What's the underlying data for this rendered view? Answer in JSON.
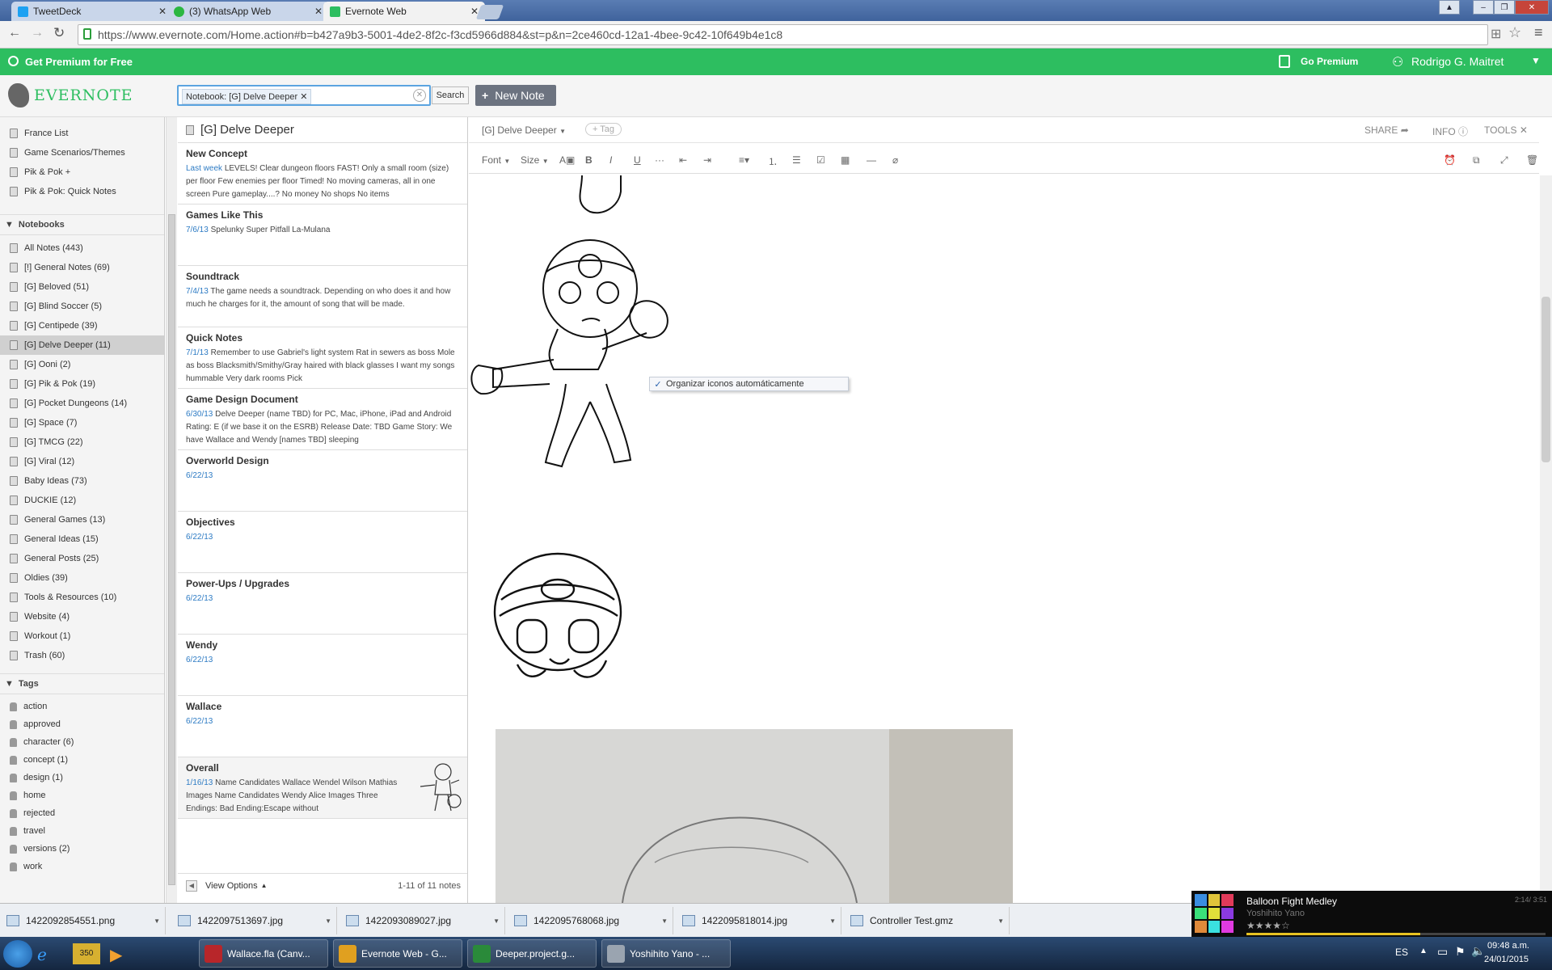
{
  "browser": {
    "tabs": [
      {
        "label": "TweetDeck",
        "color": "#1da1f2"
      },
      {
        "label": "(3) WhatsApp Web",
        "color": "#2bb741"
      },
      {
        "label": "Evernote Web",
        "color": "#2dbe60"
      }
    ],
    "url": "https://www.evernote.com/Home.action#b=b427a9b3-5001-4de2-8f2c-f3cd5966d884&st=p&n=2ce460cd-12a1-4bee-9c42-10f649b4e1c8"
  },
  "greenbar": {
    "premium_label": "Get Premium for Free",
    "go_premium": "Go Premium",
    "user_name": "Rodrigo G. Maitret"
  },
  "header": {
    "logo": "EVERNOTE",
    "search_chip": "Notebook: [G] Delve Deeper",
    "search_button": "Search",
    "new_note": "New Note"
  },
  "sidebar": {
    "shortcuts": [
      "France List",
      "Game Scenarios/Themes",
      "Pik & Pok +",
      "Pik & Pok: Quick Notes"
    ],
    "notebooks_title": "Notebooks",
    "notebooks": [
      "All Notes (443)",
      "[!] General Notes (69)",
      "[G] Beloved (51)",
      "[G] Blind Soccer (5)",
      "[G] Centipede (39)",
      "[G] Delve Deeper (11)",
      "[G] Ooni (2)",
      "[G] Pik & Pok (19)",
      "[G] Pocket Dungeons (14)",
      "[G] Space (7)",
      "[G] TMCG (22)",
      "[G] Viral (12)",
      "Baby Ideas (73)",
      "DUCKIE (12)",
      "General Games (13)",
      "General Ideas (15)",
      "General Posts (25)",
      "Oldies (39)",
      "Tools & Resources (10)",
      "Website (4)",
      "Workout (1)",
      "Trash (60)"
    ],
    "tags_title": "Tags",
    "tags": [
      "action",
      "approved",
      "character (6)",
      "concept (1)",
      "design (1)",
      "home",
      "rejected",
      "travel",
      "versions (2)",
      "work"
    ]
  },
  "notelist": {
    "title": "[G] Delve Deeper",
    "notes": [
      {
        "title": "New Concept",
        "date": "Last week",
        "text": "LEVELS! Clear dungeon floors FAST! Only a small room (size) per floor Few enemies per floor Timed! No moving cameras, all in one screen Pure gameplay....? No money No shops No items"
      },
      {
        "title": "Games Like This",
        "date": "7/6/13",
        "text": "Spelunky Super Pitfall La-Mulana"
      },
      {
        "title": "Soundtrack",
        "date": "7/4/13",
        "text": "The game needs a soundtrack. Depending on who does it and how much he charges for it, the amount of song that will be made."
      },
      {
        "title": "Quick Notes",
        "date": "7/1/13",
        "text": "Remember to use Gabriel's light system Rat in sewers as boss Mole as boss Blacksmith/Smithy/Gray haired with black glasses I want my songs hummable Very dark rooms Pick"
      },
      {
        "title": "Game Design Document",
        "date": "6/30/13",
        "text": "Delve Deeper (name TBD) for PC, Mac, iPhone, iPad and Android Rating: E (if we base it on the ESRB) Release Date: TBD Game Story: We have Wallace and Wendy [names TBD] sleeping"
      },
      {
        "title": "Overworld Design",
        "date": "6/22/13",
        "text": ""
      },
      {
        "title": "Objectives",
        "date": "6/22/13",
        "text": ""
      },
      {
        "title": "Power-Ups / Upgrades",
        "date": "6/22/13",
        "text": ""
      },
      {
        "title": "Wendy",
        "date": "6/22/13",
        "text": ""
      },
      {
        "title": "Wallace",
        "date": "6/22/13",
        "text": ""
      },
      {
        "title": "Overall",
        "date": "1/16/13",
        "text": "Name Candidates Wallace Wendel Wilson Mathias Images Name Candidates Wendy Alice Images Three Endings: Bad Ending:Escape without"
      }
    ],
    "view_options": "View Options",
    "count": "1-11 of 11 notes"
  },
  "editor": {
    "notebook": "[G] Delve Deeper",
    "tag_button": "+ Tag",
    "share": "SHARE",
    "info": "INFO",
    "tools": "TOOLS",
    "font": "Font",
    "size": "Size",
    "context_menu_item": "Organizar iconos automáticamente"
  },
  "downloads": [
    "1422092854551.png",
    "1422097513697.jpg",
    "1422093089027.jpg",
    "1422095768068.jpg",
    "1422095818014.jpg",
    "Controller Test.gmz"
  ],
  "media_widget": {
    "title": "Balloon Fight Medley",
    "artist": "Yoshihito Yano",
    "time": "2:14/ 3:51"
  },
  "taskbar": {
    "items": [
      "Wallace.fla (Canv...",
      "Evernote Web - G...",
      "Deeper.project.g...",
      "Yoshihito Yano - ..."
    ],
    "lang": "ES",
    "time": "09:48 a.m.",
    "date": "24/01/2015"
  }
}
